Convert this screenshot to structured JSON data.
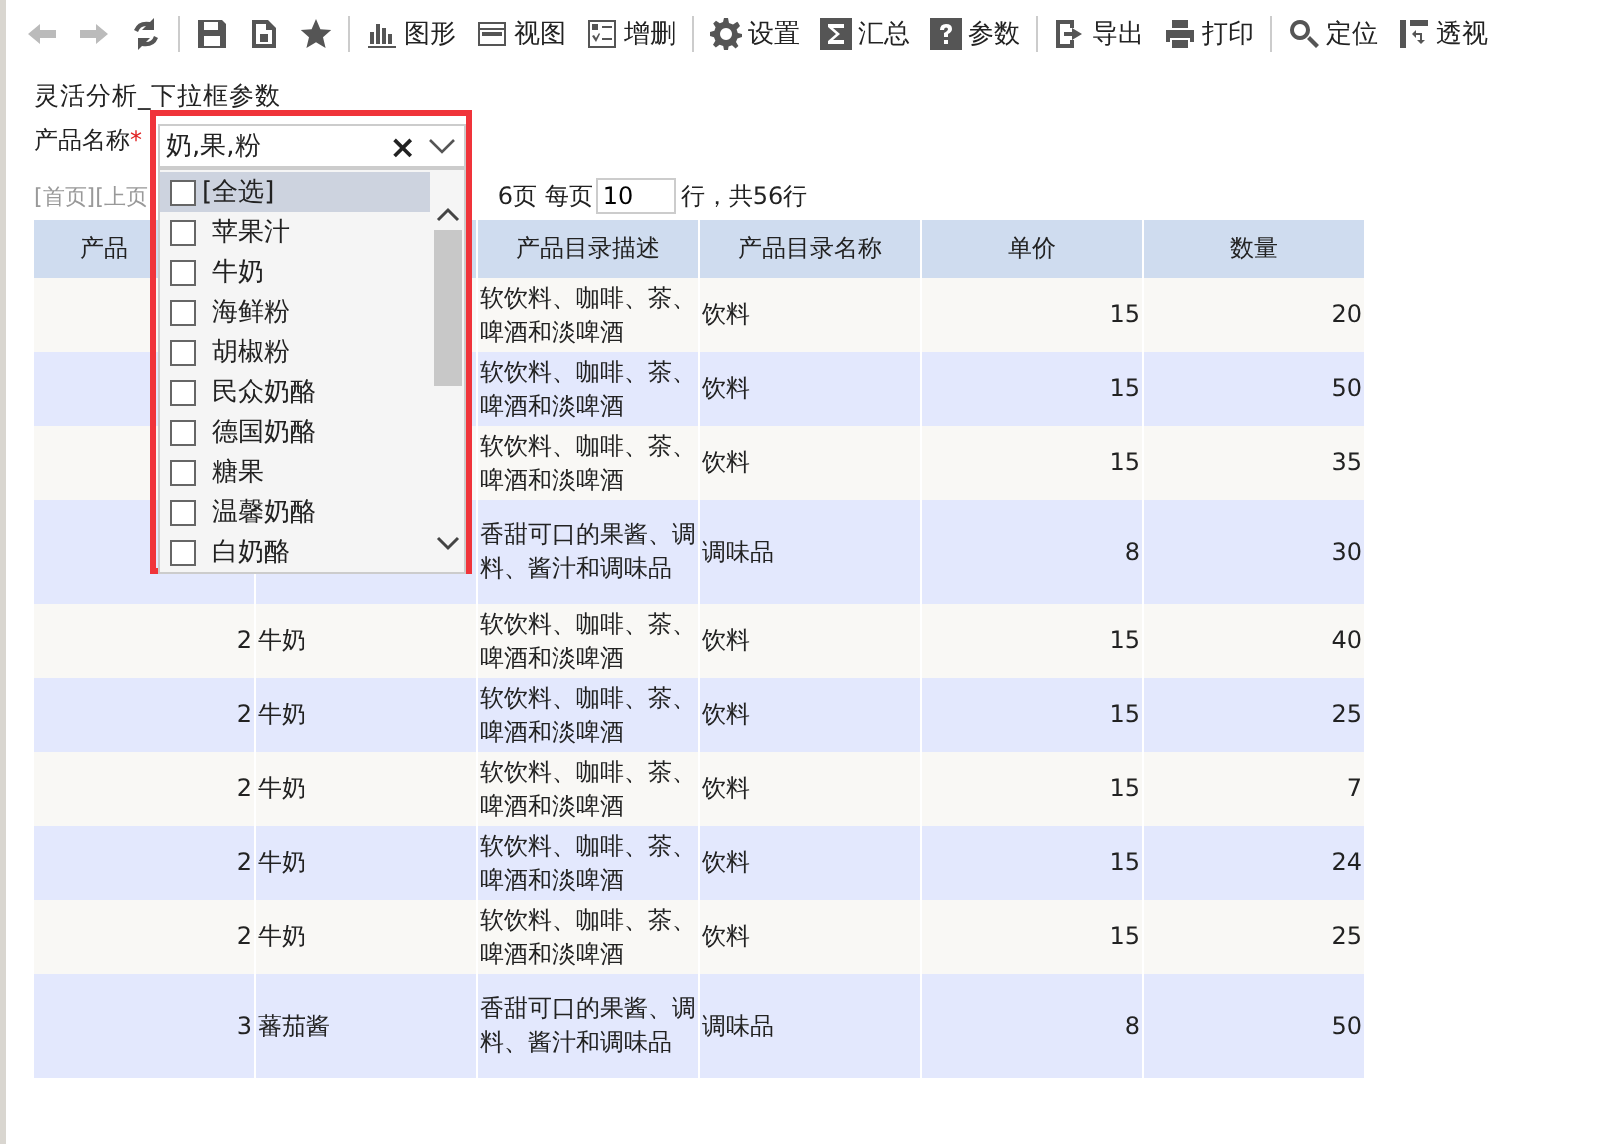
{
  "toolbar": [
    {
      "kind": "back",
      "disabled": true
    },
    {
      "kind": "forward",
      "disabled": true
    },
    {
      "kind": "refresh",
      "disabled": false
    },
    {
      "kind": "save",
      "disabled": false
    },
    {
      "kind": "save-as",
      "disabled": false
    },
    {
      "kind": "star",
      "disabled": false
    },
    {
      "kind": "chart",
      "label": "图形",
      "disabled": false
    },
    {
      "kind": "view",
      "label": "视图",
      "disabled": false
    },
    {
      "kind": "edit",
      "label": "增删",
      "disabled": false
    },
    {
      "kind": "gear",
      "label": "设置",
      "disabled": false
    },
    {
      "kind": "sum",
      "label": "汇总",
      "disabled": false
    },
    {
      "kind": "help",
      "label": "参数",
      "disabled": false
    },
    {
      "kind": "export",
      "label": "导出",
      "disabled": false
    },
    {
      "kind": "print",
      "label": "打印",
      "disabled": false
    },
    {
      "kind": "locate",
      "label": "定位",
      "disabled": false
    },
    {
      "kind": "pivot",
      "label": "透视",
      "disabled": false
    }
  ],
  "report_title": "灵活分析_下拉框参数",
  "param": {
    "label": "产品名称",
    "required_mark": "*",
    "value": "奶,果,粉",
    "clear": "×",
    "options": [
      {
        "label": "[全选]",
        "checked": false,
        "highlighted": true
      },
      {
        "label": "苹果汁",
        "checked": false,
        "highlighted": false
      },
      {
        "label": "牛奶",
        "checked": false,
        "highlighted": false
      },
      {
        "label": "海鲜粉",
        "checked": false,
        "highlighted": false
      },
      {
        "label": "胡椒粉",
        "checked": false,
        "highlighted": false
      },
      {
        "label": "民众奶酪",
        "checked": false,
        "highlighted": false
      },
      {
        "label": "德国奶酪",
        "checked": false,
        "highlighted": false
      },
      {
        "label": "糖果",
        "checked": false,
        "highlighted": false
      },
      {
        "label": "温馨奶酪",
        "checked": false,
        "highlighted": false
      },
      {
        "label": "白奶酪",
        "checked": false,
        "highlighted": false
      }
    ]
  },
  "pager": {
    "first": "[首页]",
    "prev": "[上页",
    "pages": "6页 每页",
    "per_page": "10",
    "total": "行，共56行"
  },
  "table": {
    "columns": [
      "产品",
      "",
      "产品目录描述",
      "产品目录名称",
      "单价",
      "数量"
    ],
    "rows": [
      {
        "desc": "软饮料、咖啡、茶、啤酒和淡啤酒",
        "catalog": "饮料",
        "price": "15",
        "qty": "20",
        "tall": false
      },
      {
        "desc": "软饮料、咖啡、茶、啤酒和淡啤酒",
        "catalog": "饮料",
        "price": "15",
        "qty": "50",
        "tall": false
      },
      {
        "desc": "软饮料、咖啡、茶、啤酒和淡啤酒",
        "catalog": "饮料",
        "price": "15",
        "qty": "35",
        "tall": false
      },
      {
        "desc": "香甜可口的果酱、调料、酱汁和调味品",
        "catalog": "调味品",
        "price": "8",
        "qty": "30",
        "tall": true
      },
      {
        "id": "2",
        "name": "牛奶",
        "desc": "软饮料、咖啡、茶、啤酒和淡啤酒",
        "catalog": "饮料",
        "price": "15",
        "qty": "40",
        "tall": false
      },
      {
        "id": "2",
        "name": "牛奶",
        "desc": "软饮料、咖啡、茶、啤酒和淡啤酒",
        "catalog": "饮料",
        "price": "15",
        "qty": "25",
        "tall": false
      },
      {
        "id": "2",
        "name": "牛奶",
        "desc": "软饮料、咖啡、茶、啤酒和淡啤酒",
        "catalog": "饮料",
        "price": "15",
        "qty": "7",
        "tall": false
      },
      {
        "id": "2",
        "name": "牛奶",
        "desc": "软饮料、咖啡、茶、啤酒和淡啤酒",
        "catalog": "饮料",
        "price": "15",
        "qty": "24",
        "tall": false
      },
      {
        "id": "2",
        "name": "牛奶",
        "desc": "软饮料、咖啡、茶、啤酒和淡啤酒",
        "catalog": "饮料",
        "price": "15",
        "qty": "25",
        "tall": false
      },
      {
        "id": "3",
        "name": "蕃茄酱",
        "desc": "香甜可口的果酱、调料、酱汁和调味品",
        "catalog": "调味品",
        "price": "8",
        "qty": "50",
        "tall": true
      }
    ]
  }
}
